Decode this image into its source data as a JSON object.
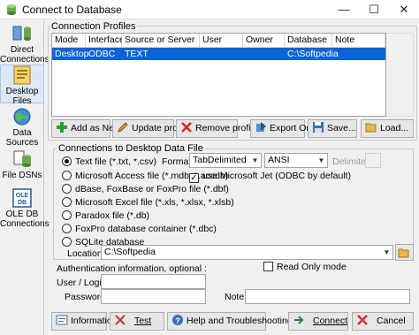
{
  "window": {
    "title": "Connect to Database"
  },
  "sidebar": {
    "items": [
      {
        "label": "Direct Connections"
      },
      {
        "label": "Desktop Files"
      },
      {
        "label": "Data Sources"
      },
      {
        "label": "File DSNs"
      },
      {
        "label": "OLE DB Connections"
      }
    ]
  },
  "profiles": {
    "group_label": "Connection Profiles",
    "columns": [
      "Mode",
      "Interface",
      "Source or Server",
      "User",
      "Owner",
      "Database",
      "Note"
    ],
    "rows": [
      {
        "mode": "Desktop",
        "interface": "ODBC",
        "source": "TEXT",
        "user": "",
        "owner": "",
        "database": "C:\\Softpedia",
        "note": ""
      }
    ],
    "buttons": {
      "add": "Add as New",
      "update": "Update profile",
      "remove": "Remove profile",
      "export": "Export One...",
      "save": "Save...",
      "load": "Load..."
    }
  },
  "desktop": {
    "group_label": "Connections to Desktop Data File",
    "options": [
      "Text file (*.txt, *.csv)",
      "Microsoft Access file (*.mdb, *.accdb)",
      "dBase, FoxBase or FoxPro file (*.dbf)",
      "Microsoft Excel file (*.xls, *.xlsx, *.xlsb)",
      "Paradox file (*.db)",
      "FoxPro database container (*.dbc)",
      "SQLite database"
    ],
    "format_label": "Format :",
    "format_value": "TabDelimited",
    "charset_value": "ANSI",
    "delimiter_label": "Delimiter :",
    "jet_label": "use Microsoft Jet (ODBC by default)",
    "location_label": "Location",
    "location_value": "C:\\Softpedia"
  },
  "auth": {
    "label": "Authentication information, optional :",
    "readonly_label": "Read Only mode",
    "user_label": "User / Login",
    "password_label": "Password",
    "note_label": "Note"
  },
  "footer": {
    "information": "Information...",
    "test": "Test",
    "help": "Help and Troubleshooting",
    "connect": "Connect",
    "cancel": "Cancel"
  }
}
